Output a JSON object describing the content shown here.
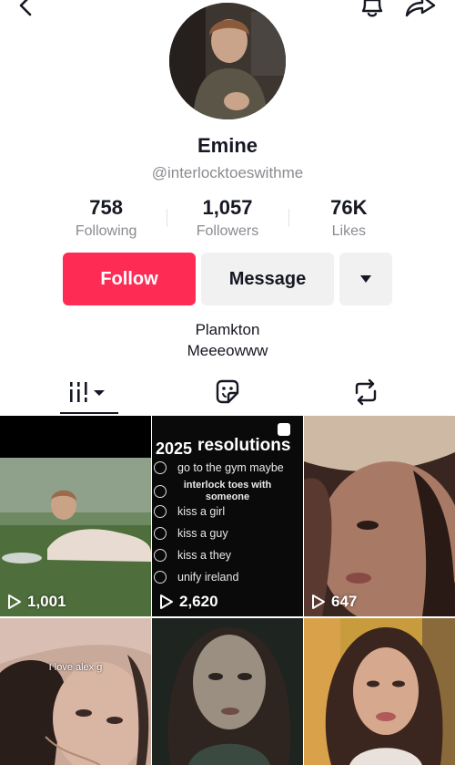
{
  "profile": {
    "name": "Emine",
    "handle": "@interlocktoeswithme",
    "bio_line1": "Plamkton",
    "bio_line2": "Meeeowww"
  },
  "stats": {
    "following": {
      "value": "758",
      "label": "Following"
    },
    "followers": {
      "value": "1,057",
      "label": "Followers"
    },
    "likes": {
      "value": "76K",
      "label": "Likes"
    }
  },
  "actions": {
    "follow_label": "Follow",
    "message_label": "Message"
  },
  "tabs": [
    {
      "name": "videos",
      "icon": "grid-icon"
    },
    {
      "name": "liked",
      "icon": "sticker-icon"
    },
    {
      "name": "reposts",
      "icon": "repost-icon"
    }
  ],
  "videos": [
    {
      "views": "1,001"
    },
    {
      "views": "2,620",
      "title_year": "2025",
      "title_word": "resolutions",
      "items": [
        "go to the gym maybe",
        "interlock toes with someone",
        "kiss a girl",
        "kiss a guy",
        "kiss a they",
        "unify ireland"
      ]
    },
    {
      "views": "647"
    },
    {
      "caption": "I love alex g"
    },
    {},
    {}
  ],
  "colors": {
    "accent": "#fe2c55",
    "secondary_button": "#f1f1f2",
    "muted_text": "#8a8b91"
  }
}
